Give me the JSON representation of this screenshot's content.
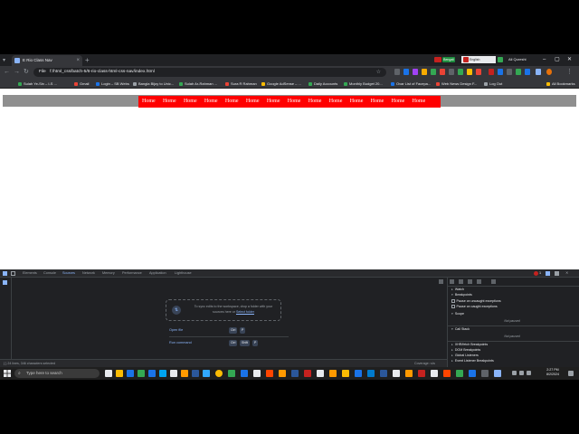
{
  "browser": {
    "tab_title": "E Rio Class Nav",
    "url_scheme": "File",
    "url": "f:/html_css/batch-5/6-rio-class-html-css-nav/index.html",
    "extension_lang": "English",
    "extension_badge": "Bengali",
    "profile_label": "Ali Qureshi",
    "all_bookmarks": "All Bookmarks",
    "bookmarks": [
      "Sulah Ye-Sin – I-S ...",
      "Gmail",
      "Login – SB Webs",
      "Bangla Bijoy to Unic...",
      "Sulah Ar-Rahman ...",
      "Sura R Rahman",
      "Google AdSense – ...",
      "Daily Accounts",
      "Monthly Budget 20...",
      "Ovar List of Facepa...",
      "Web News Design F...",
      "Log Out"
    ]
  },
  "page": {
    "nav_items": [
      "Home",
      "Home",
      "Home",
      "Home",
      "Home",
      "Home",
      "Home",
      "Home",
      "Home",
      "Home",
      "Home",
      "Home",
      "Home",
      "Home"
    ],
    "colors": {
      "nav_bg": "#ff0000",
      "bar_bg": "#8f8f8f"
    }
  },
  "devtools": {
    "tabs": [
      "Elements",
      "Console",
      "Sources",
      "Network",
      "Memory",
      "Performance",
      "Application",
      "Lighthouse"
    ],
    "active_tab": "Sources",
    "issues_count": "1",
    "workspace_text": "To sync edits to the workspace, drop a folder with your sources here or",
    "workspace_link": "Select folder",
    "shortcuts": [
      {
        "label": "Open file",
        "keys": [
          "Ctrl",
          "P"
        ]
      },
      {
        "label": "Run command",
        "keys": [
          "Ctrl",
          "Shift",
          "P"
        ]
      }
    ],
    "status_text": "{ }  24 lines, 346 characters selected",
    "coverage": "Coverage: n/a",
    "right_pane": {
      "watch": "Watch",
      "breakpoints": "Breakpoints",
      "pause_uncaught": "Pause on uncaught exceptions",
      "pause_caught": "Pause on caught exceptions",
      "scope": "Scope",
      "not_paused_1": "Not paused",
      "call_stack": "Call Stack",
      "not_paused_2": "Not paused",
      "xhr": "XHR/fetch Breakpoints",
      "dom": "DOM Breakpoints",
      "global": "Global Listeners",
      "event": "Event Listener Breakpoints"
    }
  },
  "taskbar": {
    "search_placeholder": "Type here to search",
    "time": "2:27 PM",
    "date": "8/2/2024"
  }
}
